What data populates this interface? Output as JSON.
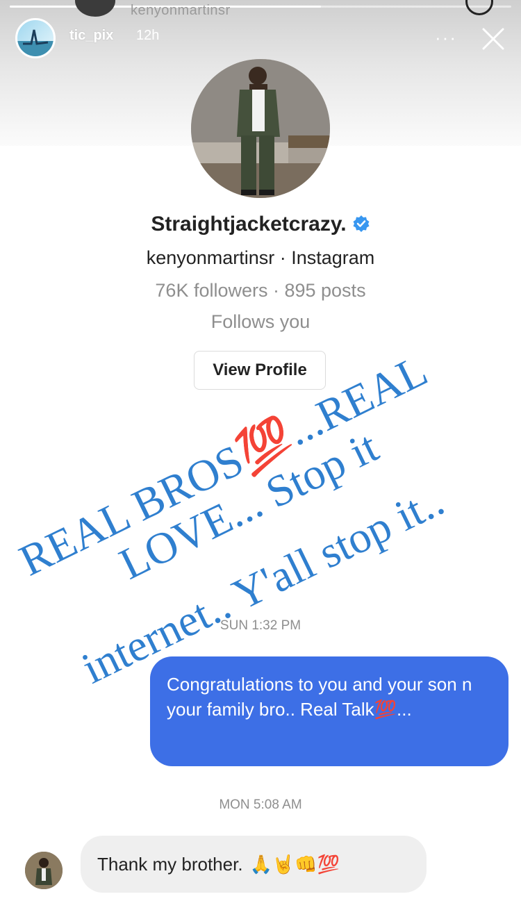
{
  "story_header": {
    "top_username": "kenyonmartinsr",
    "story_username": "tic_pix",
    "story_time": "12h",
    "progress_fraction": 0.62,
    "icons": [
      "back-arrow-icon",
      "info-icon",
      "more-options-icon",
      "close-icon"
    ]
  },
  "profile_card": {
    "display_name": "Straightjacketcrazy.",
    "verified": true,
    "handle_line": "kenyonmartinsr · Instagram",
    "stats_line": "76K followers · 895 posts",
    "follows_line": "Follows you",
    "view_profile_label": "View Profile"
  },
  "overlay_text": {
    "line1": "REAL BROS💯...REAL",
    "line2": "LOVE... Stop it",
    "line3": "internet.. Y'all stop it..",
    "color": "#2f7fcf"
  },
  "messages": [
    {
      "timestamp": "SUN 1:32 PM",
      "direction": "sent",
      "text": "Congratulations to you and your son n your family bro..  Real Talk💯..."
    },
    {
      "timestamp": "MON 5:08 AM",
      "direction": "received",
      "text": "Thank my brother.",
      "emojis": "🙏🤘👊💯"
    }
  ],
  "colors": {
    "sent_bubble": "#3d6fe6",
    "received_bubble": "#efefef",
    "verified_badge": "#3897f0",
    "hundred_emoji": "#c8102e"
  }
}
